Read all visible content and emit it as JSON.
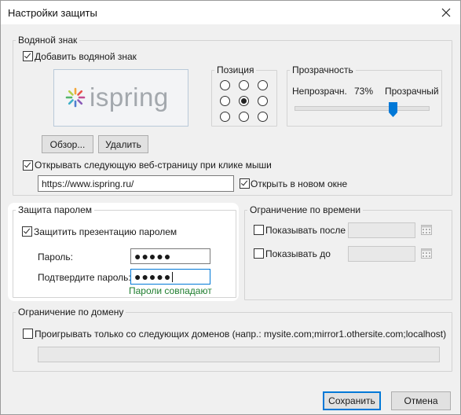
{
  "window": {
    "title": "Настройки защиты"
  },
  "watermark": {
    "legend": "Водяной знак",
    "add_label": "Добавить водяной знак",
    "add_checked": true,
    "logo_text": "ispring",
    "browse_label": "Обзор...",
    "delete_label": "Удалить",
    "position_legend": "Позиция",
    "position_selected": "center",
    "transparency_legend": "Прозрачность",
    "opaque_label": "Непрозрачн.",
    "transparent_label": "Прозрачный",
    "transparency_value": "73%",
    "transparency_fraction": 0.73,
    "open_url_label": "Открывать следующую веб-страницу при клике мыши",
    "open_url_checked": true,
    "url_value": "https://www.ispring.ru/",
    "new_window_label": "Открыть в новом окне",
    "new_window_checked": true
  },
  "password": {
    "legend": "Защита паролем",
    "protect_label": "Защитить презентацию паролем",
    "protect_checked": true,
    "password_label": "Пароль:",
    "password_value": "●●●●●",
    "confirm_label": "Подтвердите пароль:",
    "confirm_value": "●●●●●",
    "match_text": "Пароли совпадают"
  },
  "time": {
    "legend": "Ограничение по времени",
    "show_after_label": "Показывать после",
    "show_until_label": "Показывать до"
  },
  "domain": {
    "legend": "Ограничение по домену",
    "play_only_label": "Проигрывать только со следующих доменов (напр.: mysite.com;mirror1.othersite.com;localhost)"
  },
  "footer": {
    "save_label": "Сохранить",
    "cancel_label": "Отмена"
  },
  "colors": {
    "accent": "#0078d7",
    "success": "#1e7d2e",
    "logo_gray": "#a3a8ad"
  }
}
